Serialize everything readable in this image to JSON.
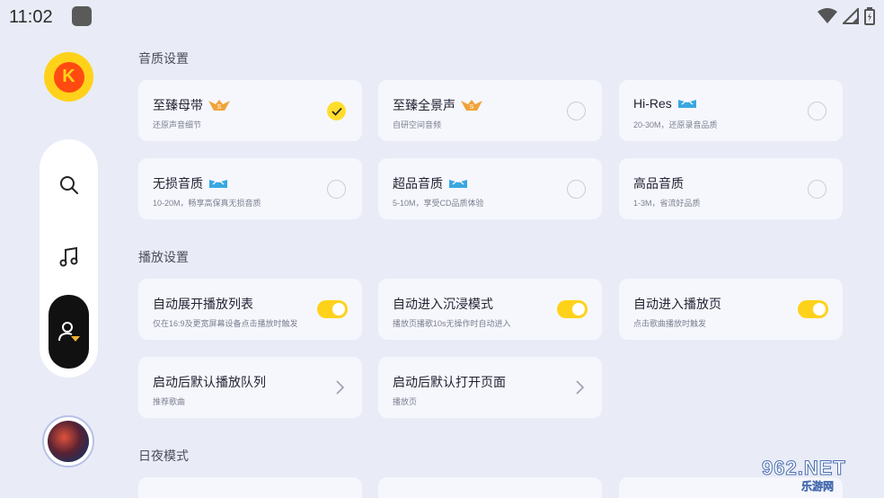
{
  "status_bar": {
    "time": "11:02"
  },
  "sections": {
    "quality": "音质设置",
    "playback": "播放设置",
    "daynight": "日夜模式"
  },
  "quality_cards": [
    {
      "title": "至臻母带",
      "sub": "还原声音细节",
      "badge": "gold",
      "checked": true
    },
    {
      "title": "至臻全景声",
      "sub": "自研空间音频",
      "badge": "gold",
      "checked": false
    },
    {
      "title": "Hi-Res",
      "sub": "20-30M，还原录音品质",
      "badge": "blue",
      "checked": false
    },
    {
      "title": "无损音质",
      "sub": "10-20M，畅享高保真无损音质",
      "badge": "blue",
      "checked": false
    },
    {
      "title": "超品音质",
      "sub": "5-10M，享受CD品质体验",
      "badge": "blue",
      "checked": false
    },
    {
      "title": "高品音质",
      "sub": "1-3M，省流好品质",
      "badge": "",
      "checked": false
    }
  ],
  "playback_cards": [
    {
      "title": "自动展开播放列表",
      "sub": "仅在16:9及更宽屏幕设备点击播放时触发",
      "control": "toggle"
    },
    {
      "title": "自动进入沉浸模式",
      "sub": "播放页播歌10s无操作时自动进入",
      "control": "toggle"
    },
    {
      "title": "自动进入播放页",
      "sub": "点击歌曲播放时触发",
      "control": "toggle"
    },
    {
      "title": "启动后默认播放队列",
      "sub": "推荐歌曲",
      "control": "chevron"
    },
    {
      "title": "启动后默认打开页面",
      "sub": "播放页",
      "control": "chevron"
    }
  ],
  "colors": {
    "accent": "#ffd21a",
    "background": "#e9ecf7",
    "card": "#f6f7fd"
  },
  "icons": {
    "logo": "kugou-logo",
    "nav": [
      "search-icon",
      "music-note-icon",
      "user-profile-icon"
    ]
  },
  "watermark": {
    "main": "962.NET",
    "sub": "乐游网"
  }
}
